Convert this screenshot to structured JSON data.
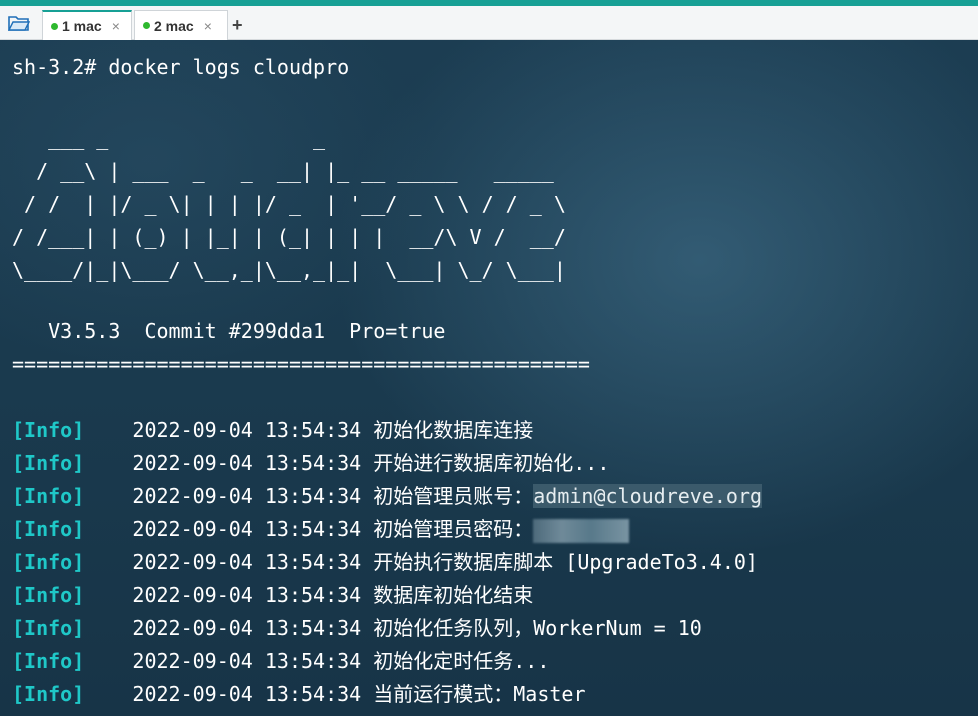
{
  "tabs": [
    {
      "label": "1 mac",
      "close": "×",
      "active": true
    },
    {
      "label": "2 mac",
      "close": "×",
      "active": false
    }
  ],
  "tab_add": "+",
  "terminal": {
    "prompt": "sh-3.2# docker logs cloudpro",
    "ascii_art": "   ___ _                 _\n  / __\\ | ___  _   _  __| |_ __ _____   _____\n / /  | |/ _ \\| | | |/ _  | '__/ _ \\ \\ / / _ \\\n/ /___| | (_) | |_| | (_| | | |  __/\\ V /  __/\n\\____/|_|\\___/ \\__,_|\\__,_|_|  \\___| \\_/ \\___|",
    "version_line": "   V3.5.3  Commit #299dda1  Pro=true",
    "separator": "================================================",
    "log": [
      {
        "tag": "[Info]",
        "time": "2022-09-04 13:54:34",
        "msg": "初始化数据库连接",
        "highlight": ""
      },
      {
        "tag": "[Info]",
        "time": "2022-09-04 13:54:34",
        "msg": "开始进行数据库初始化...",
        "highlight": ""
      },
      {
        "tag": "[Info]",
        "time": "2022-09-04 13:54:34",
        "msg": "初始管理员账号：",
        "highlight": "admin@cloudreve.org"
      },
      {
        "tag": "[Info]",
        "time": "2022-09-04 13:54:34",
        "msg": "初始管理员密码：",
        "highlight": ""
      },
      {
        "tag": "[Info]",
        "time": "2022-09-04 13:54:34",
        "msg": "开始执行数据库脚本 [UpgradeTo3.4.0]",
        "highlight": ""
      },
      {
        "tag": "[Info]",
        "time": "2022-09-04 13:54:34",
        "msg": "数据库初始化结束",
        "highlight": ""
      },
      {
        "tag": "[Info]",
        "time": "2022-09-04 13:54:34",
        "msg": "初始化任务队列，WorkerNum = 10",
        "highlight": ""
      },
      {
        "tag": "[Info]",
        "time": "2022-09-04 13:54:34",
        "msg": "初始化定时任务...",
        "highlight": ""
      },
      {
        "tag": "[Info]",
        "time": "2022-09-04 13:54:34",
        "msg": "当前运行模式：Master",
        "highlight": ""
      }
    ]
  },
  "colors": {
    "accent": "#17a095",
    "info_tag": "#1fc8c8",
    "terminal_bg": "#1a3a4e",
    "tab_dot": "#2eb82e"
  }
}
